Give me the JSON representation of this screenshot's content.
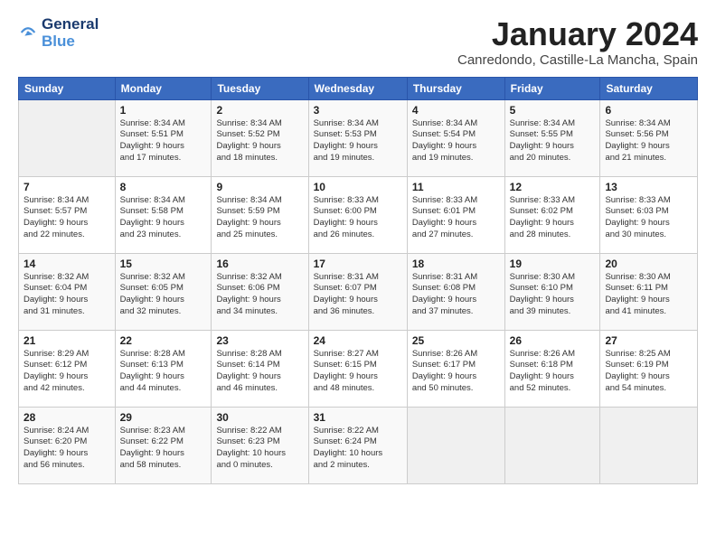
{
  "header": {
    "logo_line1": "General",
    "logo_line2": "Blue",
    "month_title": "January 2024",
    "subtitle": "Canredondo, Castille-La Mancha, Spain"
  },
  "weekdays": [
    "Sunday",
    "Monday",
    "Tuesday",
    "Wednesday",
    "Thursday",
    "Friday",
    "Saturday"
  ],
  "weeks": [
    [
      {
        "day": "",
        "info": ""
      },
      {
        "day": "1",
        "info": "Sunrise: 8:34 AM\nSunset: 5:51 PM\nDaylight: 9 hours\nand 17 minutes."
      },
      {
        "day": "2",
        "info": "Sunrise: 8:34 AM\nSunset: 5:52 PM\nDaylight: 9 hours\nand 18 minutes."
      },
      {
        "day": "3",
        "info": "Sunrise: 8:34 AM\nSunset: 5:53 PM\nDaylight: 9 hours\nand 19 minutes."
      },
      {
        "day": "4",
        "info": "Sunrise: 8:34 AM\nSunset: 5:54 PM\nDaylight: 9 hours\nand 19 minutes."
      },
      {
        "day": "5",
        "info": "Sunrise: 8:34 AM\nSunset: 5:55 PM\nDaylight: 9 hours\nand 20 minutes."
      },
      {
        "day": "6",
        "info": "Sunrise: 8:34 AM\nSunset: 5:56 PM\nDaylight: 9 hours\nand 21 minutes."
      }
    ],
    [
      {
        "day": "7",
        "info": "Sunrise: 8:34 AM\nSunset: 5:57 PM\nDaylight: 9 hours\nand 22 minutes."
      },
      {
        "day": "8",
        "info": "Sunrise: 8:34 AM\nSunset: 5:58 PM\nDaylight: 9 hours\nand 23 minutes."
      },
      {
        "day": "9",
        "info": "Sunrise: 8:34 AM\nSunset: 5:59 PM\nDaylight: 9 hours\nand 25 minutes."
      },
      {
        "day": "10",
        "info": "Sunrise: 8:33 AM\nSunset: 6:00 PM\nDaylight: 9 hours\nand 26 minutes."
      },
      {
        "day": "11",
        "info": "Sunrise: 8:33 AM\nSunset: 6:01 PM\nDaylight: 9 hours\nand 27 minutes."
      },
      {
        "day": "12",
        "info": "Sunrise: 8:33 AM\nSunset: 6:02 PM\nDaylight: 9 hours\nand 28 minutes."
      },
      {
        "day": "13",
        "info": "Sunrise: 8:33 AM\nSunset: 6:03 PM\nDaylight: 9 hours\nand 30 minutes."
      }
    ],
    [
      {
        "day": "14",
        "info": "Sunrise: 8:32 AM\nSunset: 6:04 PM\nDaylight: 9 hours\nand 31 minutes."
      },
      {
        "day": "15",
        "info": "Sunrise: 8:32 AM\nSunset: 6:05 PM\nDaylight: 9 hours\nand 32 minutes."
      },
      {
        "day": "16",
        "info": "Sunrise: 8:32 AM\nSunset: 6:06 PM\nDaylight: 9 hours\nand 34 minutes."
      },
      {
        "day": "17",
        "info": "Sunrise: 8:31 AM\nSunset: 6:07 PM\nDaylight: 9 hours\nand 36 minutes."
      },
      {
        "day": "18",
        "info": "Sunrise: 8:31 AM\nSunset: 6:08 PM\nDaylight: 9 hours\nand 37 minutes."
      },
      {
        "day": "19",
        "info": "Sunrise: 8:30 AM\nSunset: 6:10 PM\nDaylight: 9 hours\nand 39 minutes."
      },
      {
        "day": "20",
        "info": "Sunrise: 8:30 AM\nSunset: 6:11 PM\nDaylight: 9 hours\nand 41 minutes."
      }
    ],
    [
      {
        "day": "21",
        "info": "Sunrise: 8:29 AM\nSunset: 6:12 PM\nDaylight: 9 hours\nand 42 minutes."
      },
      {
        "day": "22",
        "info": "Sunrise: 8:28 AM\nSunset: 6:13 PM\nDaylight: 9 hours\nand 44 minutes."
      },
      {
        "day": "23",
        "info": "Sunrise: 8:28 AM\nSunset: 6:14 PM\nDaylight: 9 hours\nand 46 minutes."
      },
      {
        "day": "24",
        "info": "Sunrise: 8:27 AM\nSunset: 6:15 PM\nDaylight: 9 hours\nand 48 minutes."
      },
      {
        "day": "25",
        "info": "Sunrise: 8:26 AM\nSunset: 6:17 PM\nDaylight: 9 hours\nand 50 minutes."
      },
      {
        "day": "26",
        "info": "Sunrise: 8:26 AM\nSunset: 6:18 PM\nDaylight: 9 hours\nand 52 minutes."
      },
      {
        "day": "27",
        "info": "Sunrise: 8:25 AM\nSunset: 6:19 PM\nDaylight: 9 hours\nand 54 minutes."
      }
    ],
    [
      {
        "day": "28",
        "info": "Sunrise: 8:24 AM\nSunset: 6:20 PM\nDaylight: 9 hours\nand 56 minutes."
      },
      {
        "day": "29",
        "info": "Sunrise: 8:23 AM\nSunset: 6:22 PM\nDaylight: 9 hours\nand 58 minutes."
      },
      {
        "day": "30",
        "info": "Sunrise: 8:22 AM\nSunset: 6:23 PM\nDaylight: 10 hours\nand 0 minutes."
      },
      {
        "day": "31",
        "info": "Sunrise: 8:22 AM\nSunset: 6:24 PM\nDaylight: 10 hours\nand 2 minutes."
      },
      {
        "day": "",
        "info": ""
      },
      {
        "day": "",
        "info": ""
      },
      {
        "day": "",
        "info": ""
      }
    ]
  ]
}
